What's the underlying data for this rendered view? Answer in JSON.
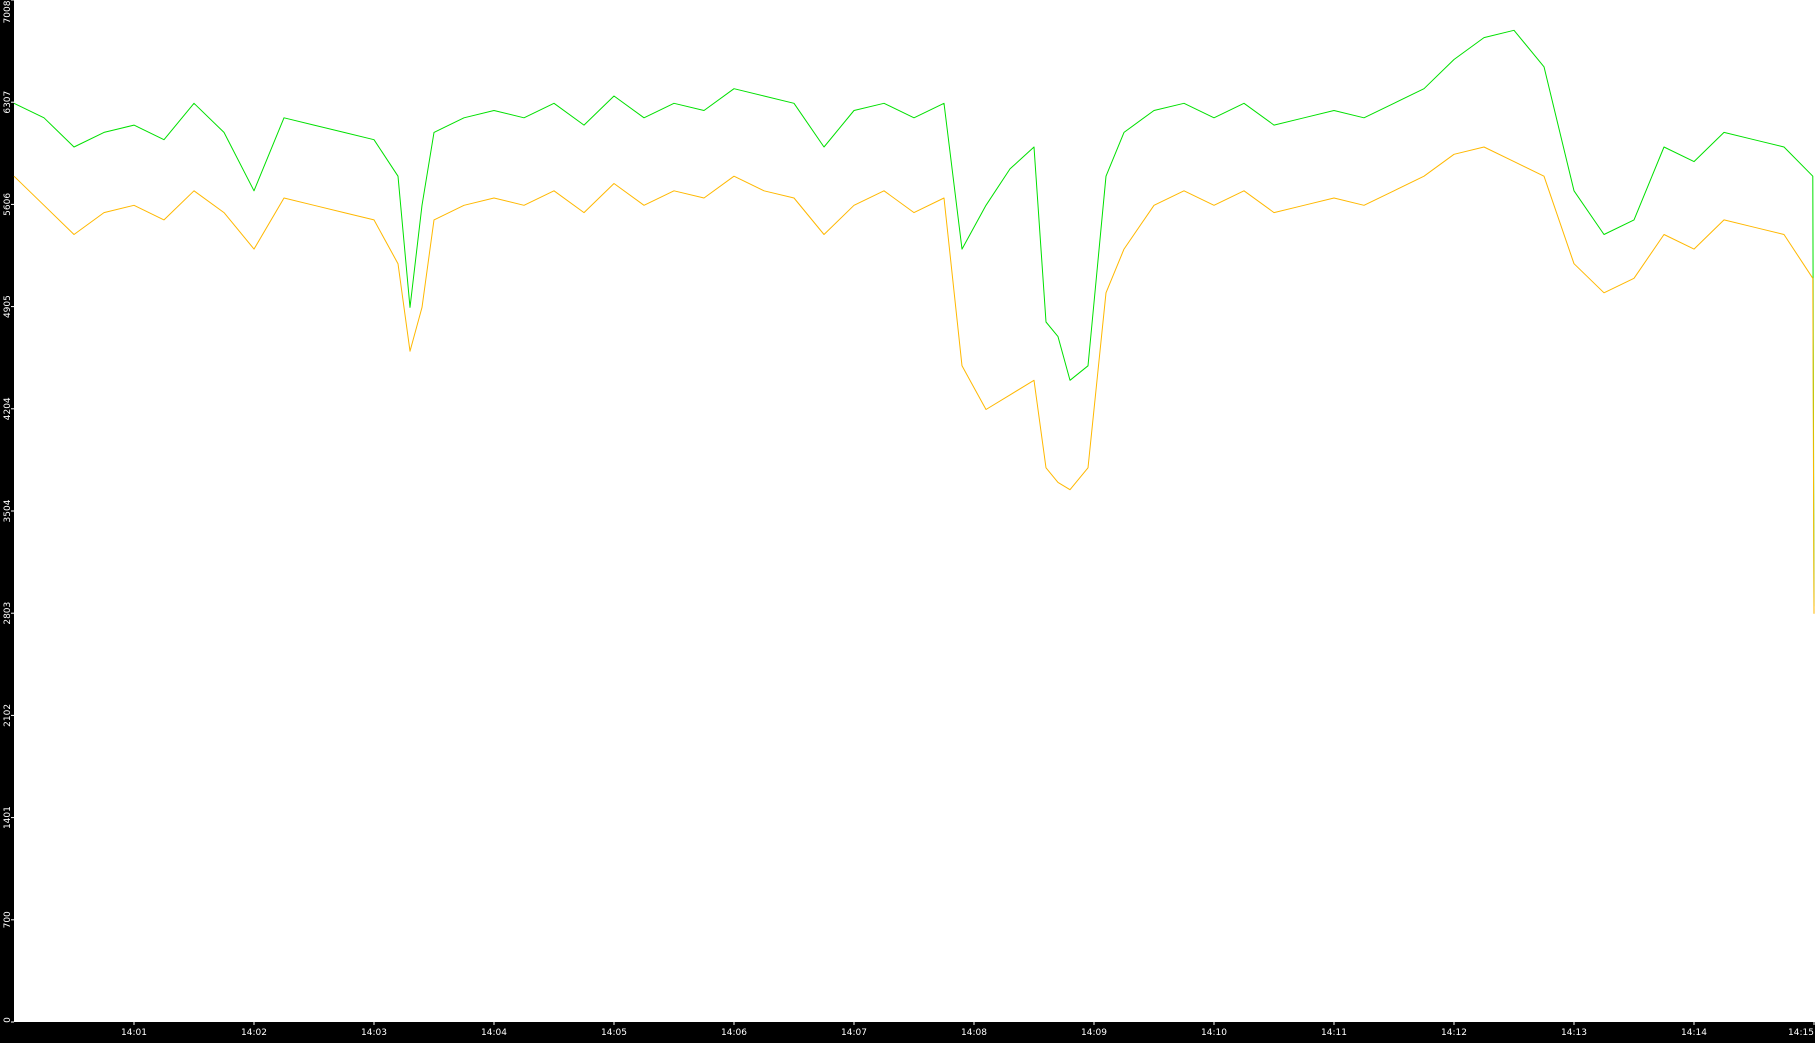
{
  "chart_data": {
    "type": "line",
    "title": "",
    "xlabel": "",
    "ylabel": "",
    "background": "#000000",
    "plot_background": "#ffffff",
    "grid": false,
    "legend": "none",
    "ylim": [
      0,
      7008
    ],
    "y_ticks": [
      "0",
      "700",
      "1401",
      "2102",
      "2803",
      "3504",
      "4204",
      "4905",
      "5606",
      "6307",
      "7008"
    ],
    "x_ticks": [
      "14:01",
      "14:02",
      "14:03",
      "14:04",
      "14:05",
      "14:06",
      "14:07",
      "14:08",
      "14:09",
      "14:10",
      "14:11",
      "14:12",
      "14:13",
      "14:14",
      "14:15"
    ],
    "x_range_minutes": [
      0,
      15
    ],
    "series": [
      {
        "color": "#00e000",
        "x": [
          0.0,
          0.25,
          0.5,
          0.75,
          1.0,
          1.25,
          1.5,
          1.75,
          2.0,
          2.25,
          2.5,
          2.75,
          3.0,
          3.2,
          3.3,
          3.4,
          3.5,
          3.75,
          4.0,
          4.25,
          4.5,
          4.75,
          5.0,
          5.25,
          5.5,
          5.75,
          6.0,
          6.25,
          6.5,
          6.75,
          7.0,
          7.25,
          7.5,
          7.75,
          7.9,
          8.1,
          8.3,
          8.5,
          8.6,
          8.7,
          8.8,
          8.95,
          9.1,
          9.25,
          9.5,
          9.75,
          10.0,
          10.25,
          10.5,
          10.75,
          11.0,
          11.25,
          11.5,
          11.75,
          12.0,
          12.25,
          12.5,
          12.75,
          13.0,
          13.25,
          13.5,
          13.75,
          14.0,
          14.25,
          14.5,
          14.75,
          14.99,
          15.0
        ],
        "y": [
          6300,
          6200,
          6000,
          6100,
          6150,
          6050,
          6300,
          6100,
          5700,
          6200,
          6150,
          6100,
          6050,
          5800,
          4900,
          5600,
          6100,
          6200,
          6250,
          6200,
          6300,
          6150,
          6350,
          6200,
          6300,
          6250,
          6400,
          6350,
          6300,
          6000,
          6250,
          6300,
          6200,
          6300,
          5300,
          5600,
          5850,
          6000,
          4800,
          4700,
          4400,
          4500,
          5800,
          6100,
          6250,
          6300,
          6200,
          6300,
          6150,
          6200,
          6250,
          6200,
          6300,
          6400,
          6600,
          6750,
          6800,
          6550,
          5700,
          5400,
          5500,
          6000,
          5900,
          6100,
          6050,
          6000,
          5800,
          2850
        ]
      },
      {
        "color": "#ffb800",
        "x": [
          0.0,
          0.25,
          0.5,
          0.75,
          1.0,
          1.25,
          1.5,
          1.75,
          2.0,
          2.25,
          2.5,
          2.75,
          3.0,
          3.2,
          3.3,
          3.4,
          3.5,
          3.75,
          4.0,
          4.25,
          4.5,
          4.75,
          5.0,
          5.25,
          5.5,
          5.75,
          6.0,
          6.25,
          6.5,
          6.75,
          7.0,
          7.25,
          7.5,
          7.75,
          7.9,
          8.1,
          8.3,
          8.5,
          8.6,
          8.7,
          8.8,
          8.95,
          9.1,
          9.25,
          9.5,
          9.75,
          10.0,
          10.25,
          10.5,
          10.75,
          11.0,
          11.25,
          11.5,
          11.75,
          12.0,
          12.25,
          12.5,
          12.75,
          13.0,
          13.25,
          13.5,
          13.75,
          14.0,
          14.25,
          14.5,
          14.75,
          14.99,
          15.0
        ],
        "y": [
          5800,
          5600,
          5400,
          5550,
          5600,
          5500,
          5700,
          5550,
          5300,
          5650,
          5600,
          5550,
          5500,
          5200,
          4600,
          4900,
          5500,
          5600,
          5650,
          5600,
          5700,
          5550,
          5750,
          5600,
          5700,
          5650,
          5800,
          5700,
          5650,
          5400,
          5600,
          5700,
          5550,
          5650,
          4500,
          4200,
          4300,
          4400,
          3800,
          3700,
          3650,
          3800,
          5000,
          5300,
          5600,
          5700,
          5600,
          5700,
          5550,
          5600,
          5650,
          5600,
          5700,
          5800,
          5950,
          6000,
          5900,
          5800,
          5200,
          5000,
          5100,
          5400,
          5300,
          5500,
          5450,
          5400,
          5100,
          2800
        ]
      }
    ]
  }
}
